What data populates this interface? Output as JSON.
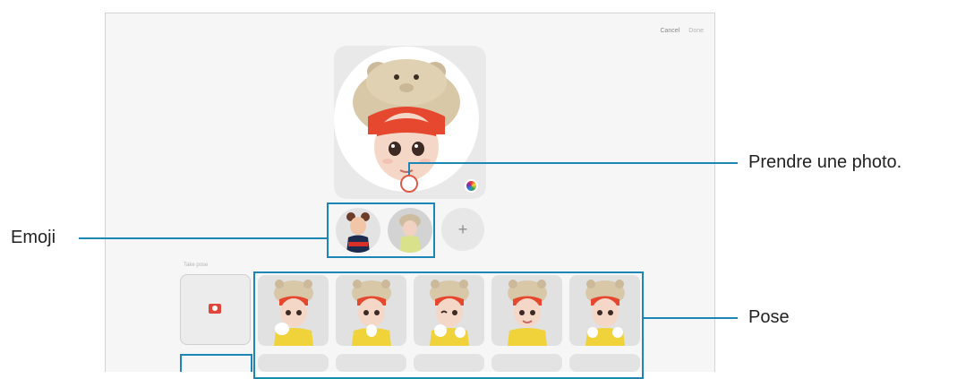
{
  "header": {
    "cancel_label": "Cancel",
    "done_label": "Done"
  },
  "poses_section": {
    "label": "Take pose"
  },
  "add_emoji": {
    "label": "+"
  },
  "callouts": {
    "photo": "Prendre une photo.",
    "emoji": "Emoji",
    "pose": "Pose"
  },
  "icons": {
    "capture": "shutter-ring-icon",
    "palette": "color-palette-icon",
    "camera": "camera-icon",
    "add": "plus-icon"
  },
  "colors": {
    "callout_accent": "#1c86b6",
    "capture_ring": "#e05a4a",
    "camera_icon": "#e2453c"
  }
}
